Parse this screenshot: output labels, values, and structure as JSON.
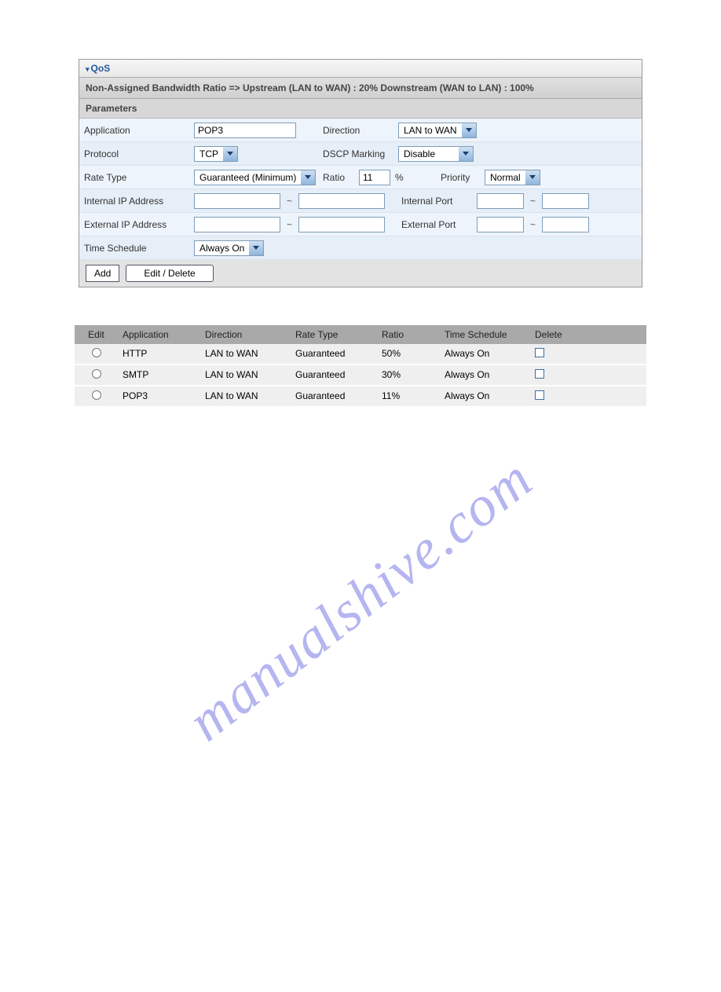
{
  "header": {
    "title": "QoS"
  },
  "banner": "Non-Assigned Bandwidth Ratio => Upstream (LAN to WAN) : 20%    Downstream (WAN to LAN) : 100%",
  "subheader": "Parameters",
  "form": {
    "application_label": "Application",
    "application_value": "POP3",
    "direction_label": "Direction",
    "direction_value": "LAN to WAN",
    "protocol_label": "Protocol",
    "protocol_value": "TCP",
    "dscp_label": "DSCP Marking",
    "dscp_value": "Disable",
    "rate_type_label": "Rate Type",
    "rate_type_value": "Guaranteed (Minimum)",
    "ratio_label": "Ratio",
    "ratio_value": "11",
    "ratio_unit": "%",
    "priority_label": "Priority",
    "priority_value": "Normal",
    "internal_ip_label": "Internal IP Address",
    "internal_ip_from": "",
    "internal_ip_to": "",
    "internal_port_label": "Internal Port",
    "internal_port_from": "",
    "internal_port_to": "",
    "external_ip_label": "External IP Address",
    "external_ip_from": "",
    "external_ip_to": "",
    "external_port_label": "External Port",
    "external_port_from": "",
    "external_port_to": "",
    "time_schedule_label": "Time Schedule",
    "time_schedule_value": "Always On",
    "range_sep": "~"
  },
  "buttons": {
    "add": "Add",
    "edit_delete": "Edit / Delete"
  },
  "grid": {
    "headers": {
      "edit": "Edit",
      "application": "Application",
      "direction": "Direction",
      "rate_type": "Rate Type",
      "ratio": "Ratio",
      "time_schedule": "Time Schedule",
      "delete": "Delete"
    },
    "rows": [
      {
        "application": "HTTP",
        "direction": "LAN to WAN",
        "rate_type": "Guaranteed",
        "ratio": "50%",
        "time_schedule": "Always On"
      },
      {
        "application": "SMTP",
        "direction": "LAN to WAN",
        "rate_type": "Guaranteed",
        "ratio": "30%",
        "time_schedule": "Always On"
      },
      {
        "application": "POP3",
        "direction": "LAN to WAN",
        "rate_type": "Guaranteed",
        "ratio": "11%",
        "time_schedule": "Always On"
      }
    ]
  },
  "watermark": "manualshive.com"
}
